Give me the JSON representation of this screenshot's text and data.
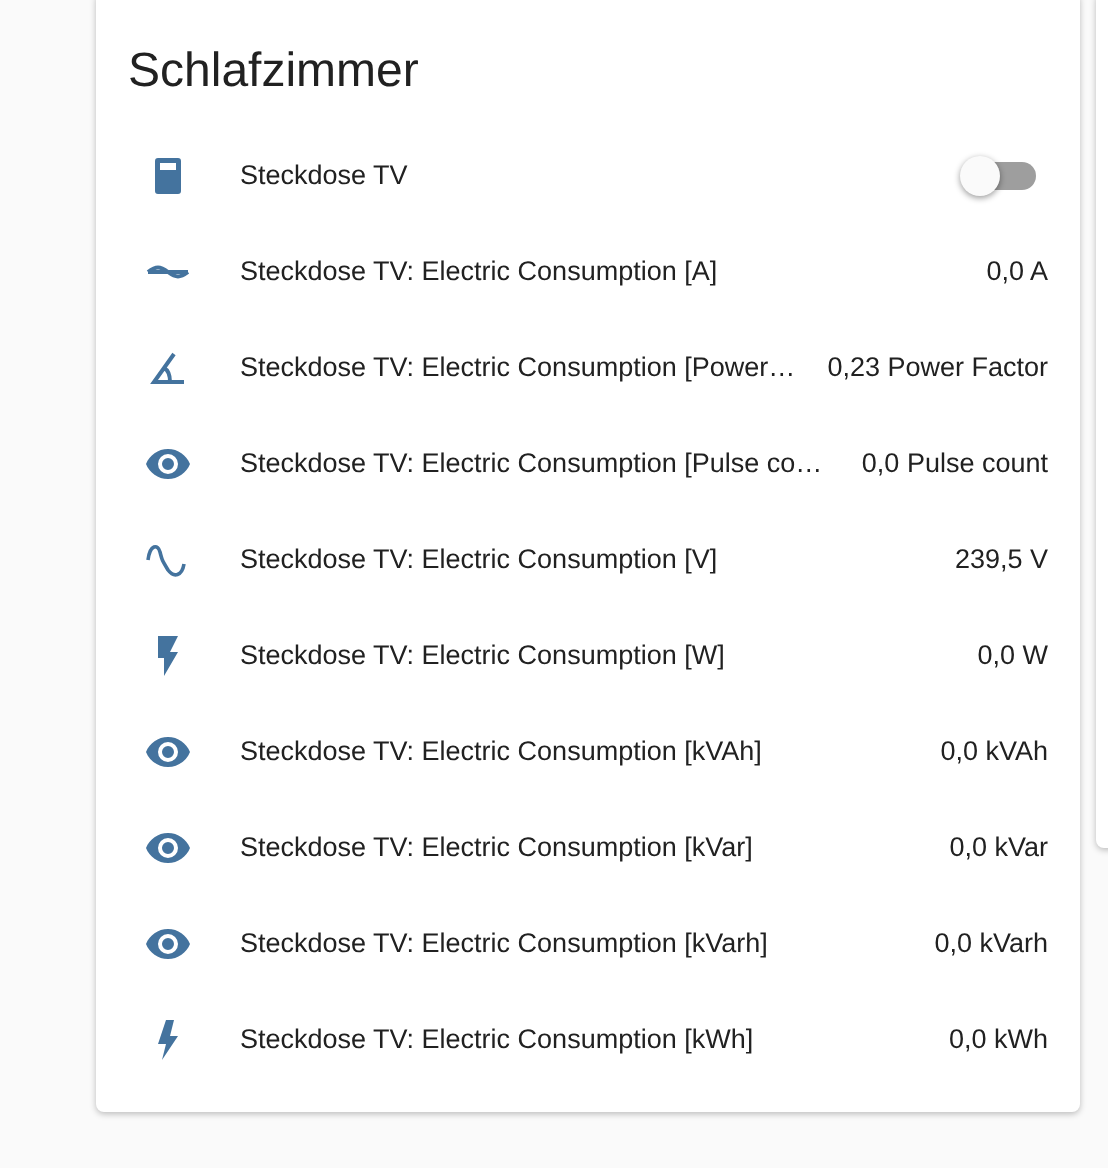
{
  "card": {
    "title": "Schlafzimmer",
    "rows": [
      {
        "kind": "switch",
        "name": "Steckdose TV",
        "on": false
      },
      {
        "kind": "sensor",
        "name": "Steckdose TV: Electric Consumption [A]",
        "value": "0,0 A"
      },
      {
        "kind": "sensor",
        "name": "Steckdose TV: Electric Consumption [Power…",
        "value": "0,23 Power Factor"
      },
      {
        "kind": "sensor",
        "name": "Steckdose TV: Electric Consumption [Pulse co…",
        "value": "0,0 Pulse count"
      },
      {
        "kind": "sensor",
        "name": "Steckdose TV: Electric Consumption [V]",
        "value": "239,5 V"
      },
      {
        "kind": "sensor",
        "name": "Steckdose TV: Electric Consumption [W]",
        "value": "0,0 W"
      },
      {
        "kind": "sensor",
        "name": "Steckdose TV: Electric Consumption [kVAh]",
        "value": "0,0 kVAh"
      },
      {
        "kind": "sensor",
        "name": "Steckdose TV: Electric Consumption [kVar]",
        "value": "0,0 kVar"
      },
      {
        "kind": "sensor",
        "name": "Steckdose TV: Electric Consumption [kVarh]",
        "value": "0,0 kVarh"
      },
      {
        "kind": "sensor",
        "name": "Steckdose TV: Electric Consumption [kWh]",
        "value": "0,0 kWh"
      }
    ]
  }
}
